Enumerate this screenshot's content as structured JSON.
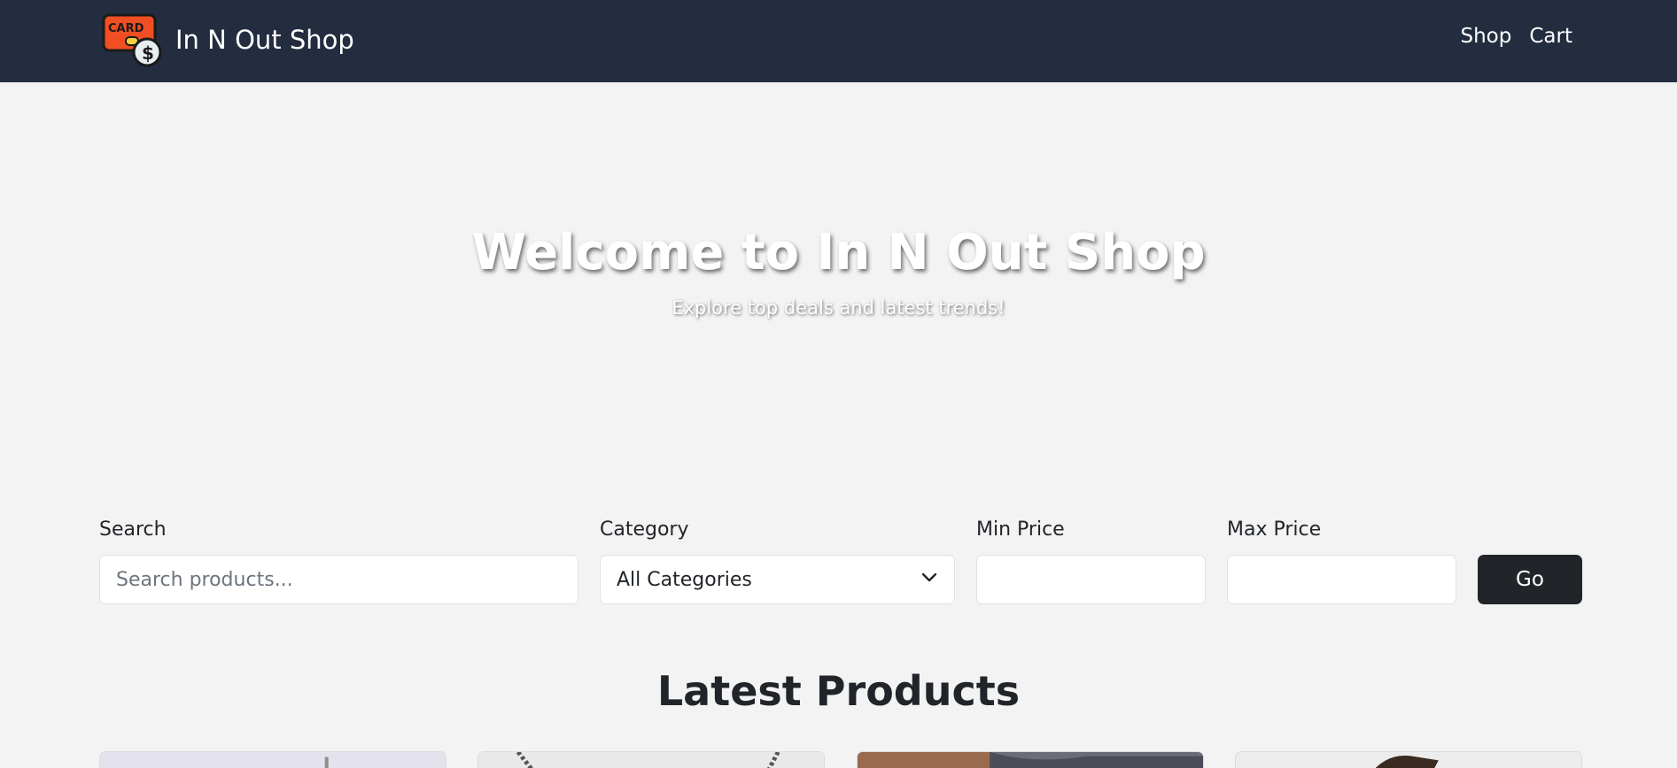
{
  "nav": {
    "brand": "In N Out Shop",
    "logo_text": "CARD",
    "logo_icon": "credit-card-dollar-icon",
    "links": [
      "Shop",
      "Cart"
    ]
  },
  "hero": {
    "title": "Welcome to In N Out Shop",
    "subtitle": "Explore top deals and latest trends!"
  },
  "filter": {
    "search_label": "Search",
    "search_placeholder": "Search products...",
    "search_value": "",
    "category_label": "Category",
    "category_value": "All Categories",
    "min_label": "Min Price",
    "min_value": "",
    "max_label": "Max Price",
    "max_value": "",
    "go_label": "Go"
  },
  "products": {
    "title": "Latest Products"
  },
  "colors": {
    "navbar": "#232d3f",
    "page_bg": "#f3f3f3",
    "button_dark": "#212529"
  }
}
